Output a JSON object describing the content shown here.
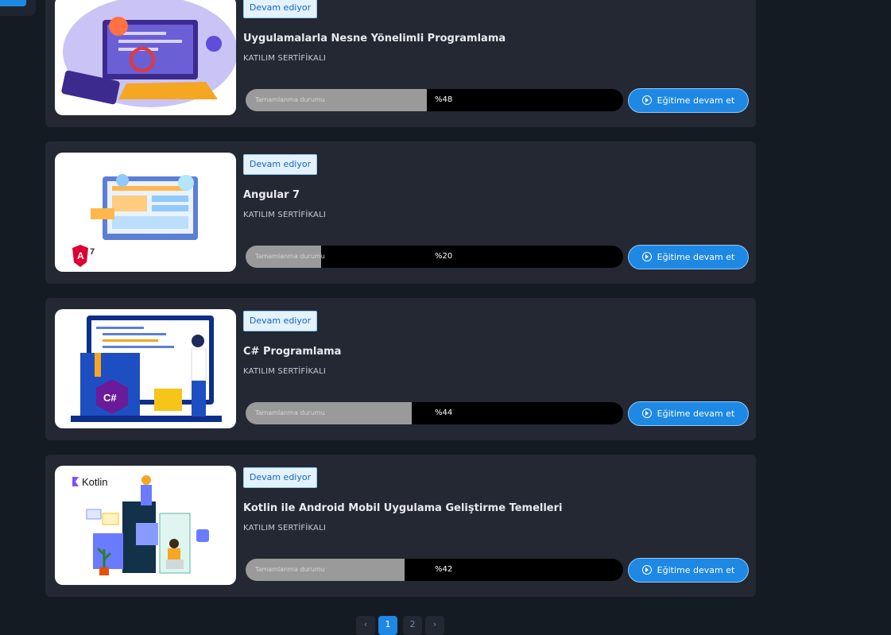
{
  "courses": [
    {
      "status": "Devam ediyor",
      "title": "Uygulamalarla Nesne Yönelimli Programlama",
      "certificate": "KATILIM SERTİFİKALI",
      "progress_label": "Tamamlanma durumu",
      "progress_text": "%48",
      "progress": 0.48,
      "cta": "Eğitime devam et",
      "image": "oop-computer-illustration"
    },
    {
      "status": "Devam ediyor",
      "title": "Angular 7",
      "certificate": "KATILIM SERTİFİKALI",
      "progress_label": "Tamamlanma durumu",
      "progress_text": "%20",
      "progress": 0.2,
      "cta": "Eğitime devam et",
      "image": "angular-illustration",
      "image_text": "7"
    },
    {
      "status": "Devam ediyor",
      "title": "C# Programlama",
      "certificate": "KATILIM SERTİFİKALI",
      "progress_label": "Tamamlanma durumu",
      "progress_text": "%44",
      "progress": 0.44,
      "cta": "Eğitime devam et",
      "image": "csharp-illustration",
      "image_text": "C#"
    },
    {
      "status": "Devam ediyor",
      "title": "Kotlin ile Android Mobil Uygulama Geliştirme Temelleri",
      "certificate": "KATILIM SERTİFİKALI",
      "progress_label": "Tamamlanma durumu",
      "progress_text": "%42",
      "progress": 0.42,
      "cta": "Eğitime devam et",
      "image": "kotlin-illustration",
      "image_text": "Kotlin"
    }
  ],
  "pagination": {
    "prev": "‹",
    "pages": [
      "1",
      "2"
    ],
    "active": "1",
    "next": "›"
  },
  "colors": {
    "background": "#151b23",
    "card": "#232832",
    "accent": "#1e88e5",
    "badge_bg": "#e3f2fd",
    "progress_fill": "#9a9a9a",
    "progress_track": "#000000"
  }
}
